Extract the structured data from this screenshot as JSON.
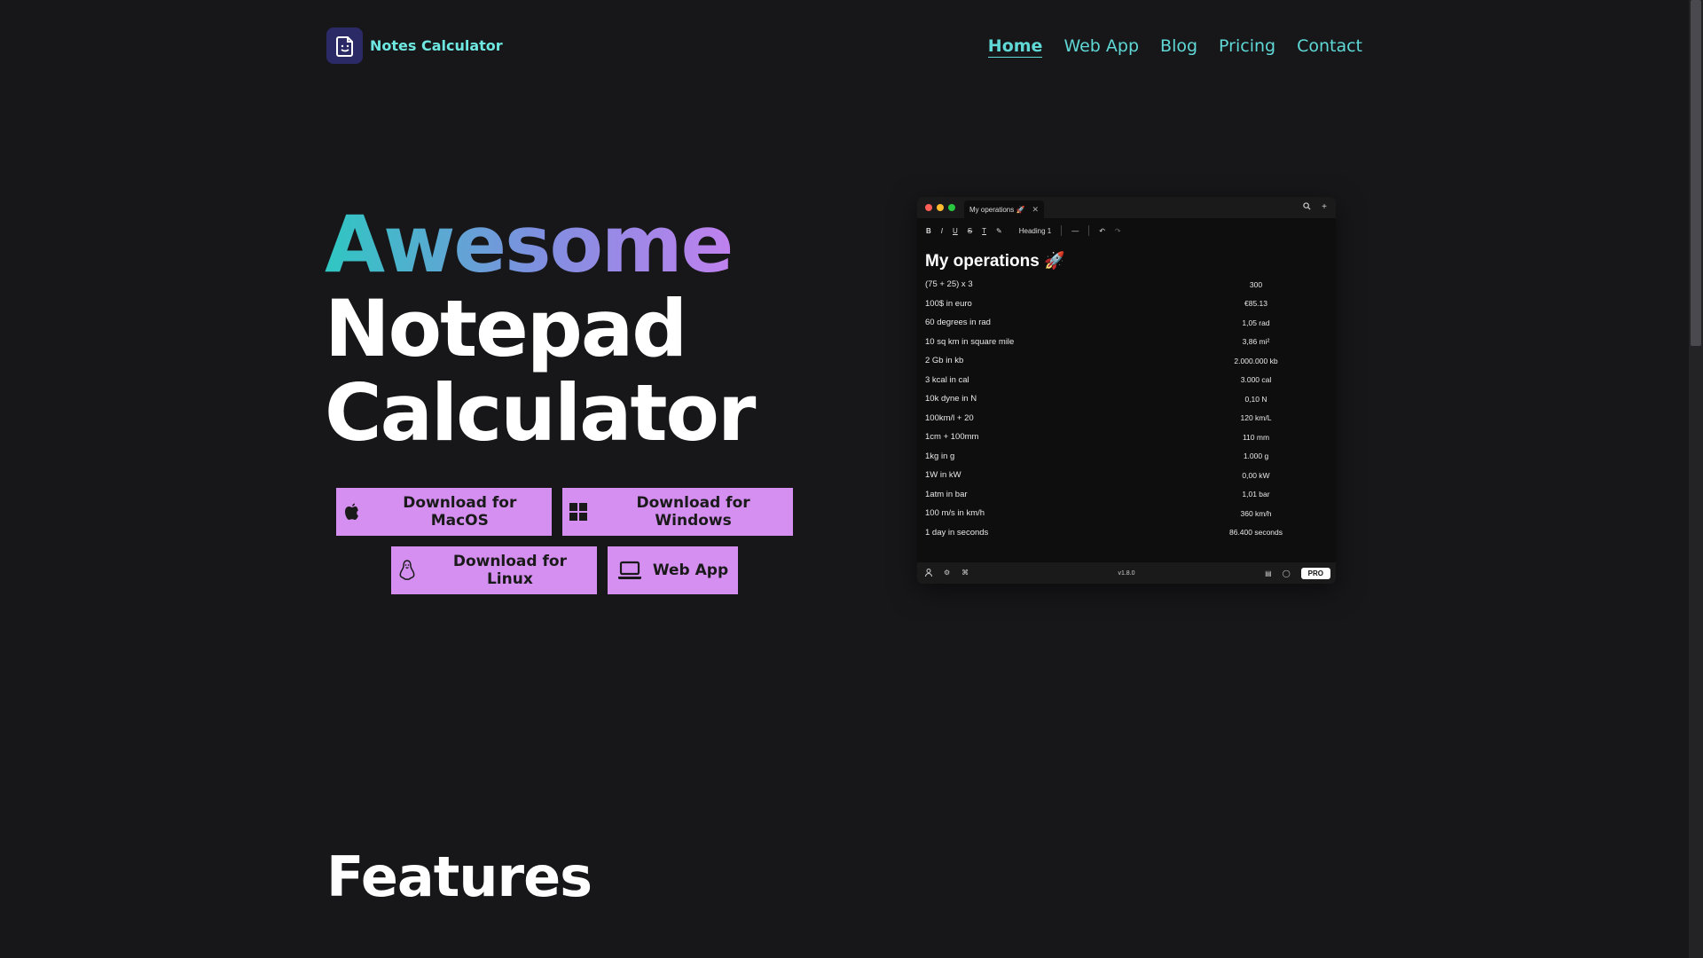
{
  "brand": {
    "name": "Notes Calculator",
    "logo_icon": "note-face-icon",
    "accent": "#5fd8d6"
  },
  "nav": {
    "items": [
      {
        "label": "Home",
        "active": true
      },
      {
        "label": "Web App"
      },
      {
        "label": "Blog"
      },
      {
        "label": "Pricing"
      },
      {
        "label": "Contact"
      }
    ]
  },
  "hero": {
    "title_gradient": "Awesome",
    "title_line2": "Notepad",
    "title_line3": "Calculator",
    "gradient_colors": [
      "#2fc7c2",
      "#7f8fe0",
      "#c77ff0"
    ]
  },
  "buttons": {
    "macos": {
      "label": "Download for MacOS",
      "icon": "apple-icon"
    },
    "windows": {
      "label": "Download for Windows",
      "icon": "windows-icon"
    },
    "linux": {
      "label": "Download for Linux",
      "icon": "linux-icon"
    },
    "webapp": {
      "label": "Web App",
      "icon": "laptop-icon"
    },
    "color": "#d48ff0"
  },
  "preview": {
    "tab_title": "My operations 🚀",
    "toolbar": {
      "bold": "B",
      "italic": "I",
      "underline": "U",
      "strike": "S",
      "heading": "Heading 1"
    },
    "doc_title": "My operations 🚀",
    "rows": [
      {
        "expr": "(75 + 25) x 3",
        "result": "300"
      },
      {
        "expr": "100$ in euro",
        "result": "€85.13"
      },
      {
        "expr": "60 degrees in rad",
        "result": "1,05 rad"
      },
      {
        "expr": "10 sq km in square mile",
        "result": "3,86 mi²"
      },
      {
        "expr": "2 Gb in kb",
        "result": "2.000.000 kb"
      },
      {
        "expr": "3 kcal in cal",
        "result": "3.000 cal"
      },
      {
        "expr": "10k dyne in N",
        "result": "0,10 N"
      },
      {
        "expr": "100km/l + 20",
        "result": "120 km/L"
      },
      {
        "expr": "1cm + 100mm",
        "result": "110 mm"
      },
      {
        "expr": "1kg in g",
        "result": "1.000 g"
      },
      {
        "expr": "1W in kW",
        "result": "0,00 kW"
      },
      {
        "expr": "1atm in bar",
        "result": "1,01 bar"
      },
      {
        "expr": "100 m/s in km/h",
        "result": "360 km/h"
      },
      {
        "expr": "1 day in seconds",
        "result": "86.400 seconds"
      }
    ],
    "version": "v1.8.0",
    "pro_label": "PRO"
  },
  "features": {
    "heading": "Features"
  }
}
